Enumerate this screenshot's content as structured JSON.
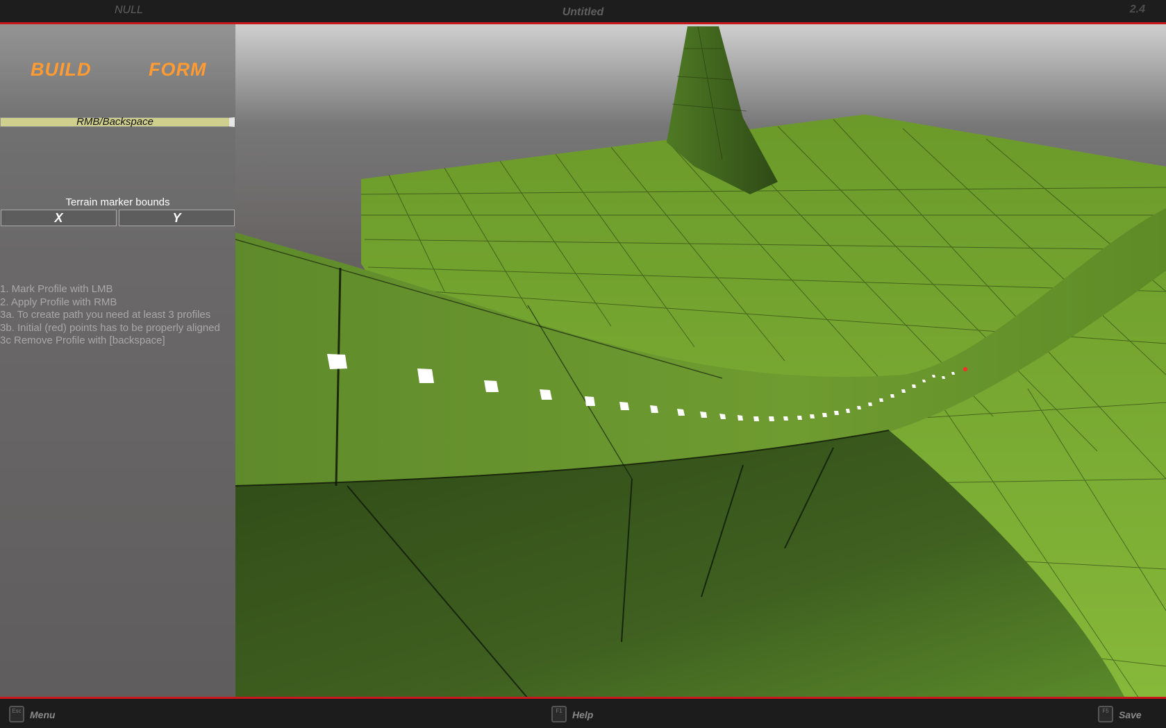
{
  "header": {
    "left_label": "NULL",
    "title": "Untitled",
    "version": "2.4"
  },
  "panel": {
    "tabs": [
      {
        "label": "BUILD"
      },
      {
        "label": "FORM"
      }
    ],
    "hint_bar": "RMB/Backspace",
    "bounds_label": "Terrain marker bounds",
    "bound_x": "X",
    "bound_y": "Y",
    "instructions": [
      "1. Mark Profile with LMB",
      "2. Apply Profile with RMB",
      "3a. To create path you need at least 3 profiles",
      "3b. Initial (red) points has to be properly aligned",
      "3c Remove Profile with [backspace]"
    ]
  },
  "footer": {
    "menu": {
      "key": "Esc",
      "label": "Menu"
    },
    "help": {
      "key": "F1",
      "label": "Help"
    },
    "save": {
      "key": "F5",
      "label": "Save"
    }
  },
  "colors": {
    "accent_orange": "#ff9b33",
    "bar_red": "#c8171d",
    "terrain_green": "#6f9a2e",
    "marker_red": "#ff2a2a"
  }
}
